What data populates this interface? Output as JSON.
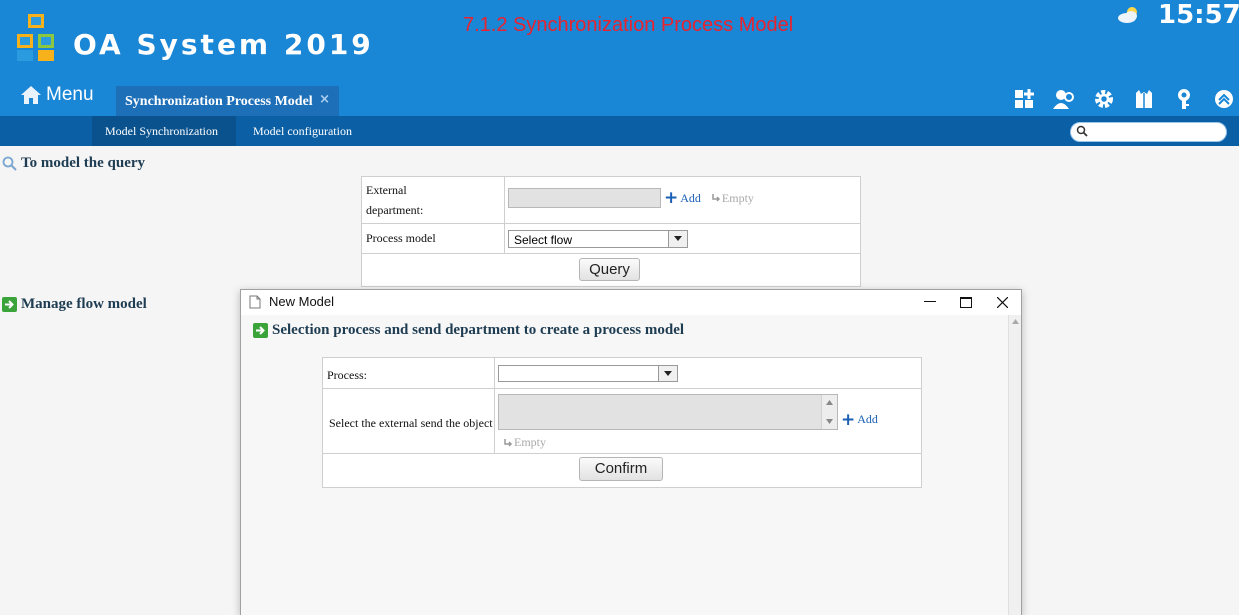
{
  "app": {
    "title": "OA System 2019",
    "banner": "7.1.2 Synchronization Process Model",
    "clock": "15:57"
  },
  "nav": {
    "menu_label": "Menu",
    "active_tab": "Synchronization Process Model",
    "close_symbol": "×"
  },
  "subnav": {
    "items": [
      "Model Synchronization",
      "Model configuration"
    ],
    "search_placeholder": ""
  },
  "query": {
    "title": "To model the query",
    "external_label_1": "External",
    "external_label_2": "department:",
    "add_label": "Add",
    "empty_label": "Empty",
    "process_label": "Process model",
    "process_select": "Select flow",
    "button": "Query"
  },
  "manage": {
    "title": "Manage flow model"
  },
  "dialog": {
    "title": "New Model",
    "heading": "Selection process and send department to create a process model",
    "process_label": "Process:",
    "process_select": "",
    "object_label": "Select the external send the object",
    "add_label": "Add",
    "empty_label": "Empty",
    "confirm": "Confirm"
  },
  "colors": {
    "header": "#1a86d6",
    "subnav": "#0b5fa5",
    "banner": "#e8232f"
  },
  "icons": [
    "logo-icon",
    "weather-icon",
    "home-icon",
    "apps-icon",
    "users-icon",
    "gear-icon",
    "shirt-icon",
    "key-icon",
    "collapse-icon",
    "search-icon",
    "arrow-right-icon"
  ]
}
